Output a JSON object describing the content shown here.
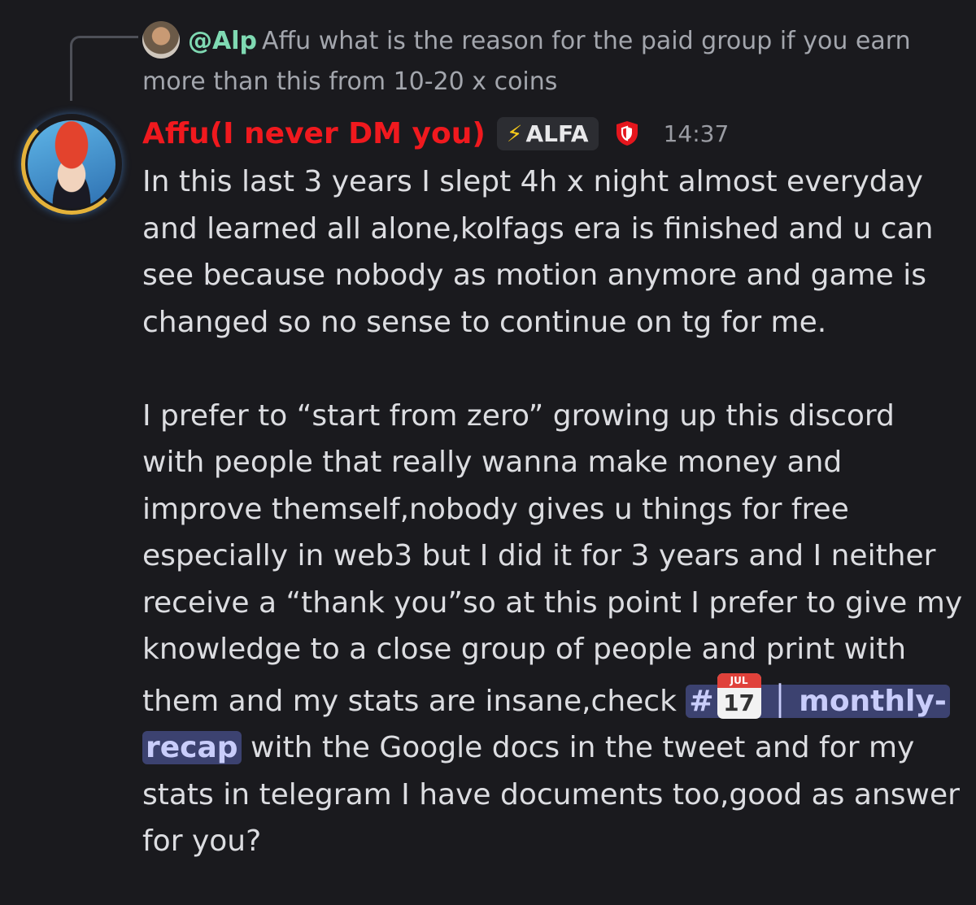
{
  "reply": {
    "mention": "@Alp",
    "text": "Affu what is the reason for the paid group if you earn more than this from 10-20 x coins"
  },
  "message": {
    "author": "Affu(I never DM you)",
    "tag": "ALFA",
    "timestamp": "14:37",
    "paragraph1": "In this last 3 years I slept 4h x night almost everyday and learned all alone,kolfags era is finished and u can see because nobody as motion anymore and game is changed so no sense to continue on tg for me.",
    "paragraph2_before": "I prefer to “start from zero” growing up this discord with people that really wanna make money and improve themself,nobody gives u things for free especially in web3 but I did it for 3 years and I neither receive a “thank you”so at this point I prefer to give my knowledge to a close group of people and print with them and my stats are insane,check ",
    "channel": {
      "hash": "#",
      "cal_month": "JUL",
      "cal_day": "17",
      "name": "│ monthly-recap"
    },
    "paragraph2_after": " with the Google docs in the tweet and for my stats in telegram I have documents too,good as answer for you?"
  },
  "icons": {
    "tag_icon": "lightning-bolt-icon",
    "role_icon": "red-shield-icon",
    "channel_icon": "calendar-icon"
  },
  "colors": {
    "background": "#1a1a1e",
    "author": "#f0191e",
    "mention": "#7fd9b2",
    "channel_bg": "#3c4270"
  }
}
